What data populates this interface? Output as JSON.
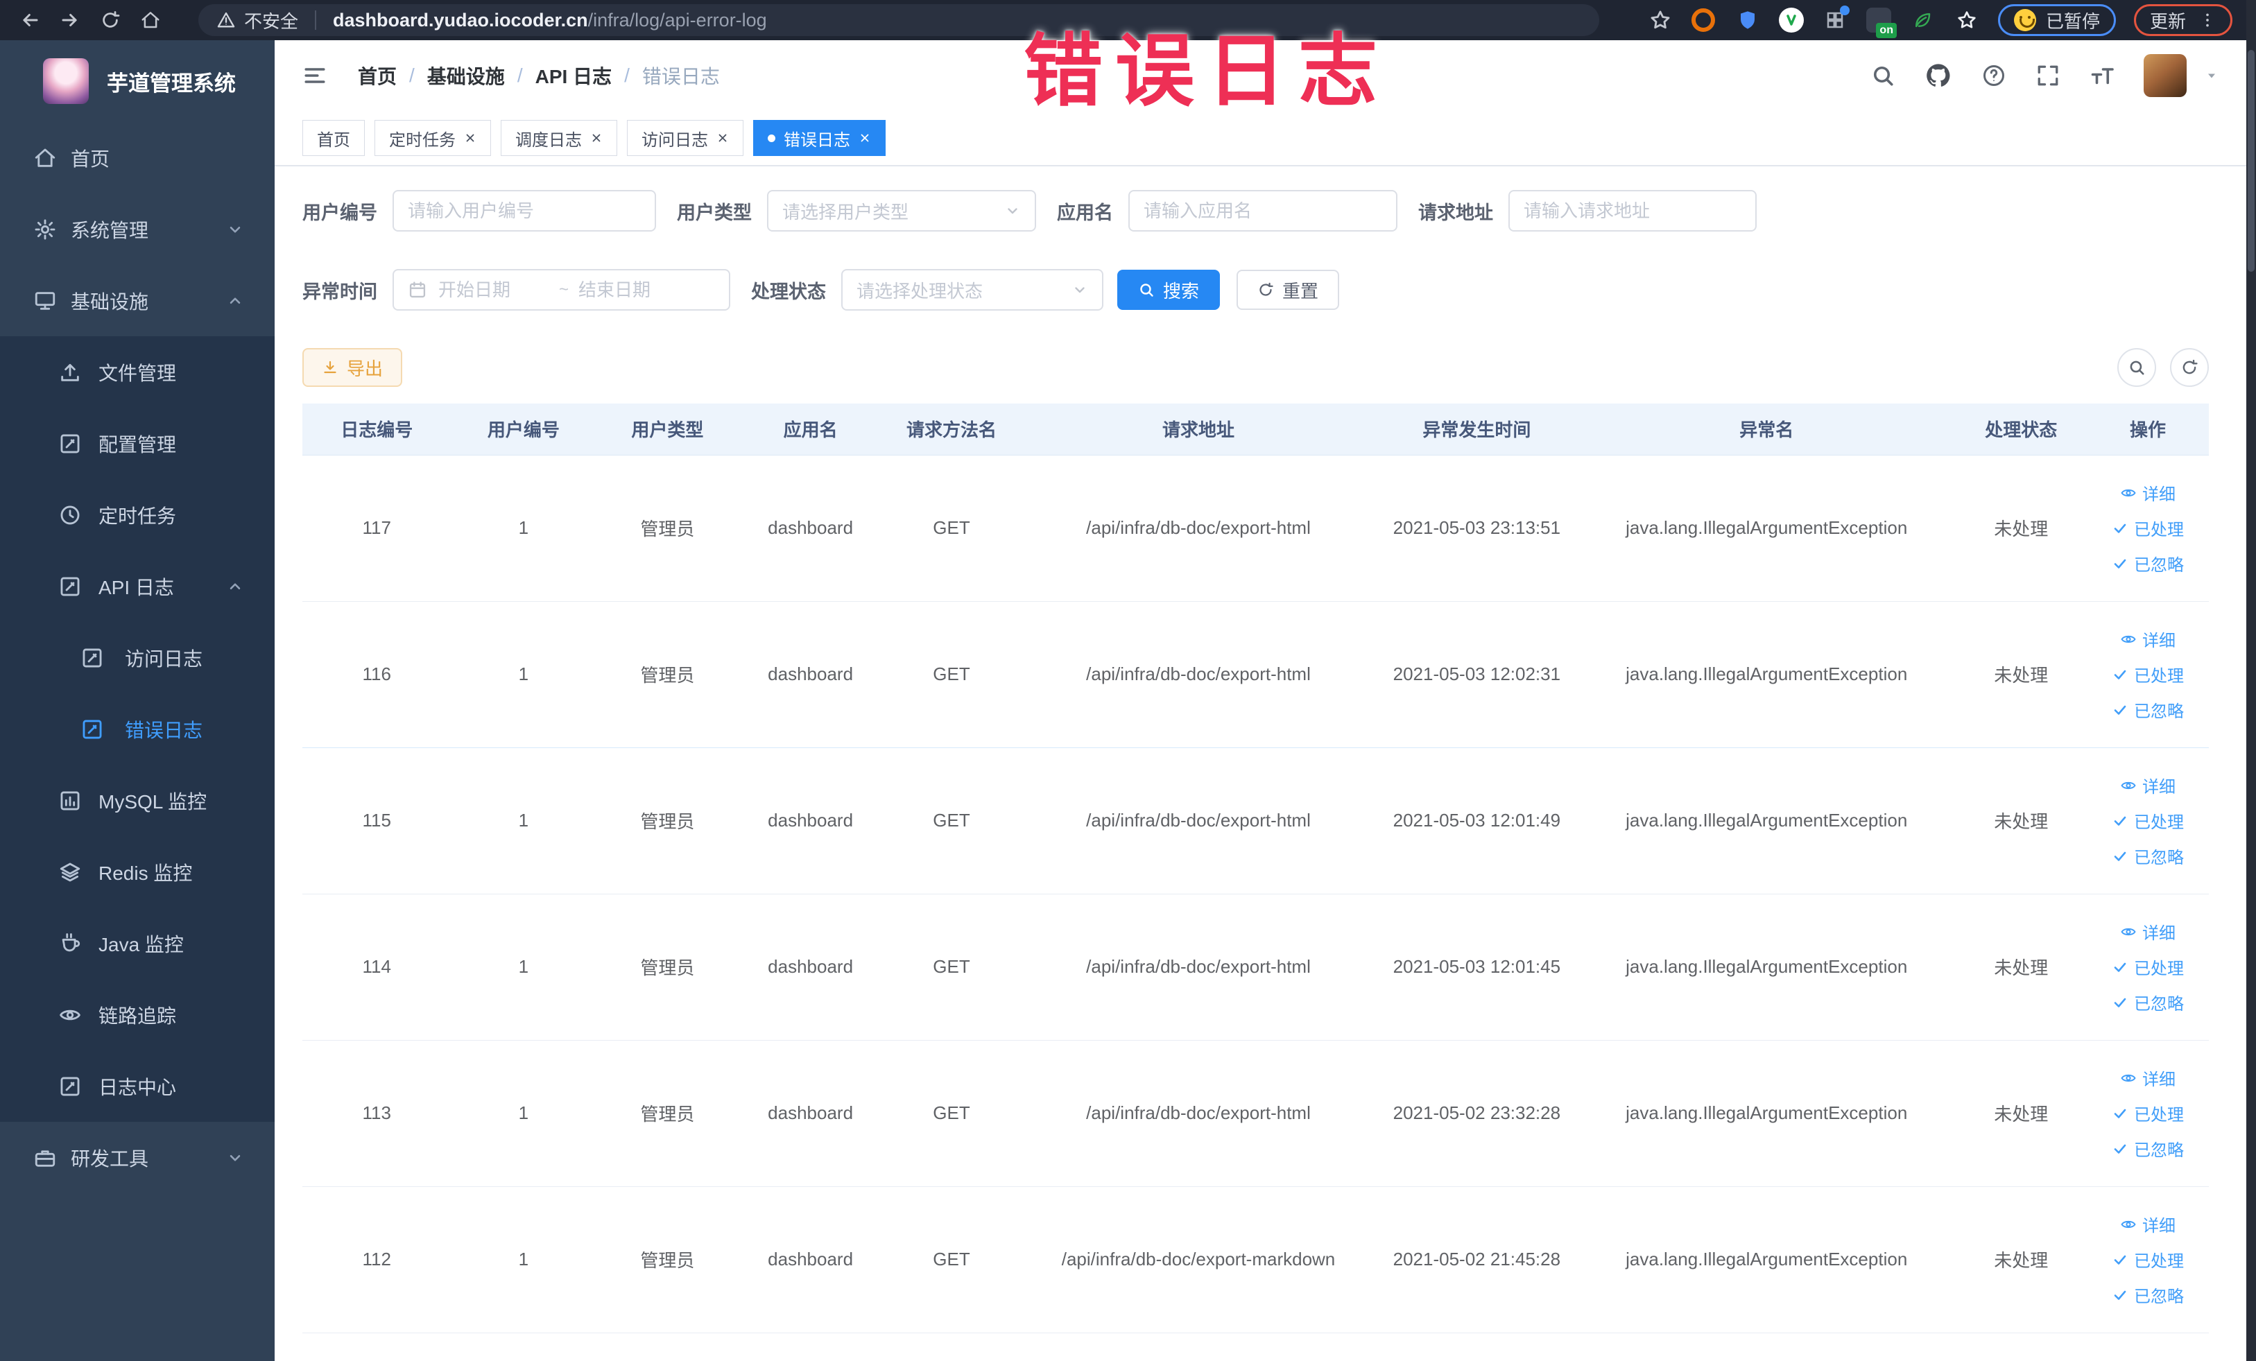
{
  "browser": {
    "security_label": "不安全",
    "url_domain": "dashboard.yudao.iocoder.cn",
    "url_path": "/infra/log/api-error-log",
    "paused_label": "已暂停",
    "update_label": "更新",
    "extension_on_badge": "on"
  },
  "annotation": {
    "text": "错误日志",
    "color": "#ee2f55"
  },
  "sidebar": {
    "title": "芋道管理系统",
    "menu": [
      {
        "key": "home",
        "label": "首页",
        "icon": "home",
        "level": 1,
        "dark": false,
        "chevron": "",
        "active": false
      },
      {
        "key": "system",
        "label": "系统管理",
        "icon": "gear",
        "level": 1,
        "dark": false,
        "chevron": "down",
        "active": false
      },
      {
        "key": "infra",
        "label": "基础设施",
        "icon": "monitor",
        "level": 1,
        "dark": false,
        "chevron": "up",
        "active": false
      },
      {
        "key": "file",
        "label": "文件管理",
        "icon": "upload",
        "level": 2,
        "dark": true,
        "chevron": "",
        "active": false
      },
      {
        "key": "config",
        "label": "配置管理",
        "icon": "log",
        "level": 2,
        "dark": true,
        "chevron": "",
        "active": false
      },
      {
        "key": "job",
        "label": "定时任务",
        "icon": "clock",
        "level": 2,
        "dark": true,
        "chevron": "",
        "active": false
      },
      {
        "key": "api-log",
        "label": "API 日志",
        "icon": "log",
        "level": 2,
        "dark": true,
        "chevron": "up",
        "active": false
      },
      {
        "key": "access-log",
        "label": "访问日志",
        "icon": "log",
        "level": 3,
        "dark": true,
        "chevron": "",
        "active": false
      },
      {
        "key": "error-log",
        "label": "错误日志",
        "icon": "log",
        "level": 3,
        "dark": true,
        "chevron": "",
        "active": true
      },
      {
        "key": "mysql",
        "label": "MySQL 监控",
        "icon": "chart",
        "level": 2,
        "dark": true,
        "chevron": "",
        "active": false
      },
      {
        "key": "redis",
        "label": "Redis 监控",
        "icon": "layers",
        "level": 2,
        "dark": true,
        "chevron": "",
        "active": false
      },
      {
        "key": "java",
        "label": "Java 监控",
        "icon": "java",
        "level": 2,
        "dark": true,
        "chevron": "",
        "active": false
      },
      {
        "key": "trace",
        "label": "链路追踪",
        "icon": "eye",
        "level": 2,
        "dark": true,
        "chevron": "",
        "active": false
      },
      {
        "key": "log-center",
        "label": "日志中心",
        "icon": "log",
        "level": 2,
        "dark": true,
        "chevron": "",
        "active": false
      },
      {
        "key": "dev-tools",
        "label": "研发工具",
        "icon": "briefcase",
        "level": 1,
        "dark": false,
        "chevron": "down",
        "active": false
      }
    ]
  },
  "header": {
    "breadcrumb": [
      "首页",
      "基础设施",
      "API 日志",
      "错误日志"
    ],
    "separator": "/"
  },
  "tabs": [
    {
      "label": "首页",
      "closable": false,
      "active": false
    },
    {
      "label": "定时任务",
      "closable": true,
      "active": false
    },
    {
      "label": "调度日志",
      "closable": true,
      "active": false
    },
    {
      "label": "访问日志",
      "closable": true,
      "active": false
    },
    {
      "label": "错误日志",
      "closable": true,
      "active": true
    }
  ],
  "filters": {
    "fields_row1": [
      {
        "label": "用户编号",
        "placeholder": "请输入用户编号"
      },
      {
        "label": "用户类型",
        "placeholder": "请选择用户类型"
      },
      {
        "label": "应用名",
        "placeholder": "请输入应用名"
      },
      {
        "label": "请求地址",
        "placeholder": "请输入请求地址"
      }
    ],
    "fields_row2": [
      {
        "label": "异常时间",
        "start_placeholder": "开始日期",
        "separator": "~",
        "end_placeholder": "结束日期"
      },
      {
        "label": "处理状态",
        "placeholder": "请选择处理状态"
      }
    ],
    "search_label": "搜索",
    "reset_label": "重置"
  },
  "toolbar": {
    "export_label": "导出"
  },
  "table": {
    "columns": [
      "日志编号",
      "用户编号",
      "用户类型",
      "应用名",
      "请求方法名",
      "请求地址",
      "异常发生时间",
      "异常名",
      "处理状态",
      "操作"
    ],
    "action_labels": [
      "详细",
      "已处理",
      "已忽略"
    ],
    "rows": [
      {
        "id": "117",
        "user_id": "1",
        "user_type": "管理员",
        "app": "dashboard",
        "method": "GET",
        "url": "/api/infra/db-doc/export-html",
        "time": "2021-05-03 23:13:51",
        "exception": "java.lang.IllegalArgumentException",
        "status": "未处理"
      },
      {
        "id": "116",
        "user_id": "1",
        "user_type": "管理员",
        "app": "dashboard",
        "method": "GET",
        "url": "/api/infra/db-doc/export-html",
        "time": "2021-05-03 12:02:31",
        "exception": "java.lang.IllegalArgumentException",
        "status": "未处理"
      },
      {
        "id": "115",
        "user_id": "1",
        "user_type": "管理员",
        "app": "dashboard",
        "method": "GET",
        "url": "/api/infra/db-doc/export-html",
        "time": "2021-05-03 12:01:49",
        "exception": "java.lang.IllegalArgumentException",
        "status": "未处理"
      },
      {
        "id": "114",
        "user_id": "1",
        "user_type": "管理员",
        "app": "dashboard",
        "method": "GET",
        "url": "/api/infra/db-doc/export-html",
        "time": "2021-05-03 12:01:45",
        "exception": "java.lang.IllegalArgumentException",
        "status": "未处理"
      },
      {
        "id": "113",
        "user_id": "1",
        "user_type": "管理员",
        "app": "dashboard",
        "method": "GET",
        "url": "/api/infra/db-doc/export-html",
        "time": "2021-05-02 23:32:28",
        "exception": "java.lang.IllegalArgumentException",
        "status": "未处理"
      },
      {
        "id": "112",
        "user_id": "1",
        "user_type": "管理员",
        "app": "dashboard",
        "method": "GET",
        "url": "/api/infra/db-doc/export-markdown",
        "time": "2021-05-02 21:45:28",
        "exception": "java.lang.IllegalArgumentException",
        "status": "未处理"
      }
    ]
  },
  "colors": {
    "accent": "#2688f3",
    "link": "#419ef9",
    "sidebar_bg": "#304156",
    "sidebar_submenu_bg": "#24344a",
    "active_menu": "#409eff",
    "warning_button": "#e6a23c",
    "table_header_bg": "#edf4fc",
    "annotation": "#ee2f55"
  }
}
